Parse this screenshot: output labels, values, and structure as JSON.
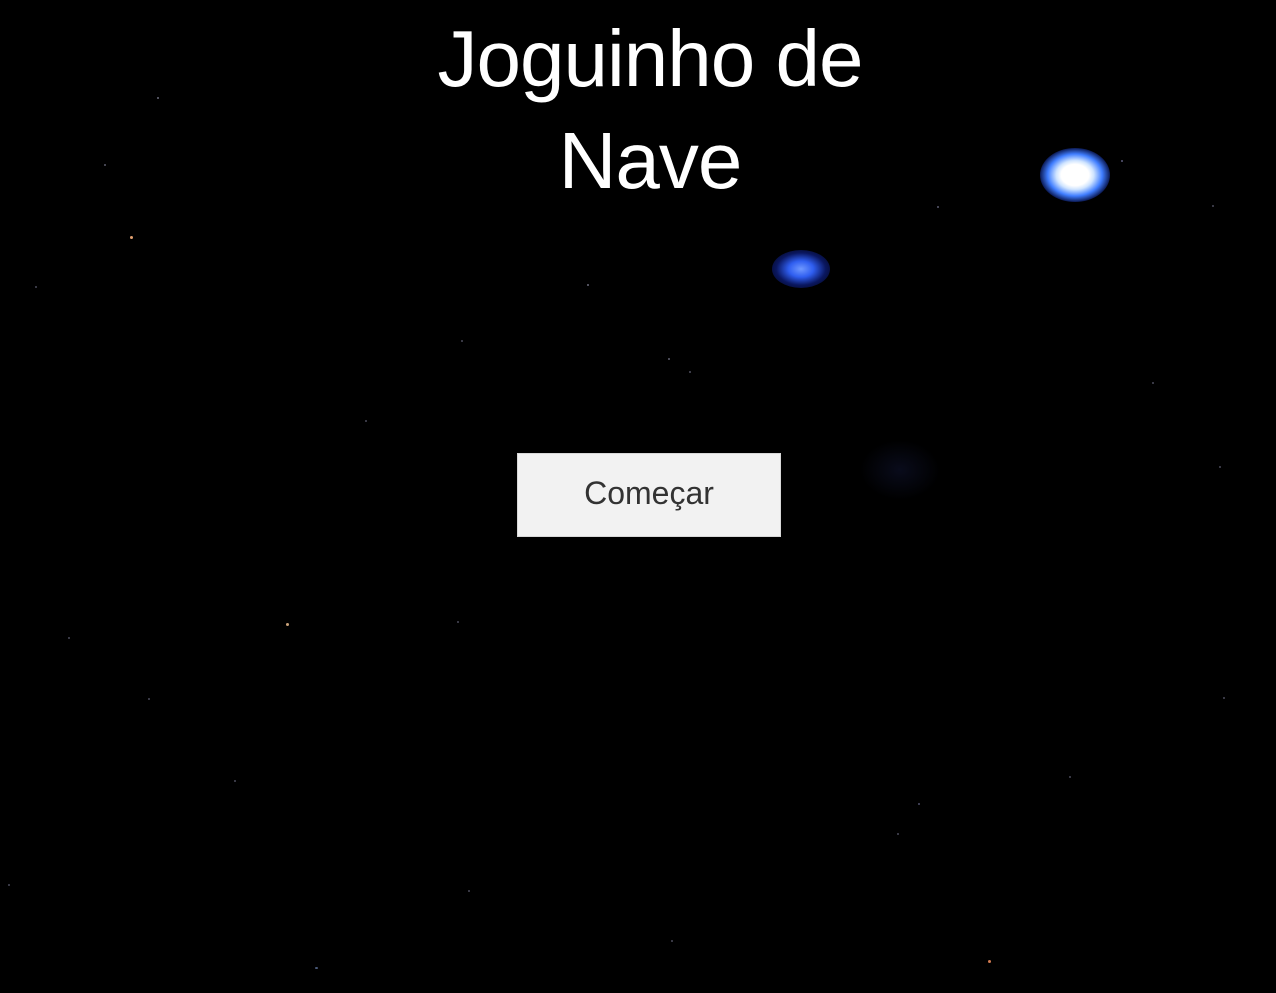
{
  "game": {
    "title_line1": "Joguinho de",
    "title_line2": "Nave",
    "start_button_label": "Começar"
  },
  "colors": {
    "background": "#000000",
    "title_text": "#ffffff",
    "button_background": "#f2f2f2",
    "button_text": "#333333",
    "star_glow": "#3f7dff"
  },
  "icons": [
    "glowing-star-icon",
    "star-icon"
  ]
}
